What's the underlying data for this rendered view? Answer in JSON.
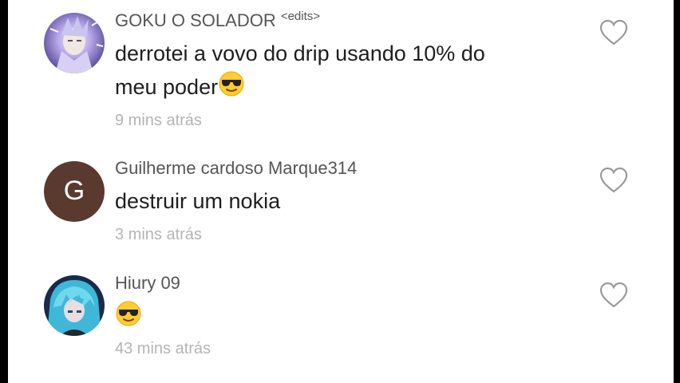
{
  "comments": [
    {
      "username": "GOKU O SOLADOR ",
      "username_tag": "<edits>",
      "text_line1": "derrotei a vovo do drip usando 10% do",
      "text_line2": "meu poder",
      "emoji": "sunglasses-emoji",
      "time": "9 mins atrás",
      "avatar": "anime-avatar-goku"
    },
    {
      "username": "Guilherme cardoso Marque314",
      "text_line1": "destruir um nokia",
      "time": "3 mins atrás",
      "avatar_letter": "G",
      "avatar_color": "#5a3a2e"
    },
    {
      "username": "Hiury 09",
      "emoji": "sunglasses-emoji",
      "time": "43 mins atrás",
      "avatar": "anime-avatar-blue-hair"
    }
  ],
  "colors": {
    "username": "#555555",
    "text": "#1e1e1e",
    "time": "#b4b4b4",
    "heart_outline": "#9a9a9a"
  },
  "icons": {
    "like": "heart-outline-icon"
  }
}
